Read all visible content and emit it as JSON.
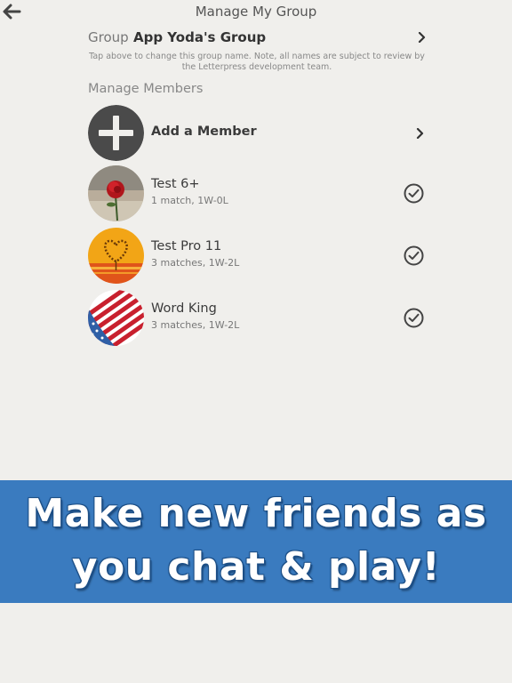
{
  "header": {
    "title": "Manage My Group",
    "back_icon": "arrow-left-icon"
  },
  "group": {
    "label": "Group",
    "name": "App Yoda's Group",
    "note": "Tap above to change this group name. Note, all names are subject to review by the Letterpress development team."
  },
  "members_section": {
    "title": "Manage Members",
    "add_label": "Add a Member",
    "members": [
      {
        "name": "Test 6+",
        "stats": "1 match, 1W-0L",
        "avatar": "rose-photo",
        "selected": true
      },
      {
        "name": "Test Pro 11",
        "stats": "3 matches, 1W-2L",
        "avatar": "sunset-heart-photo",
        "selected": true
      },
      {
        "name": "Word King",
        "stats": "3 matches, 1W-2L",
        "avatar": "flag-globe-photo",
        "selected": true
      }
    ]
  },
  "banner": {
    "line1": "Make new friends as",
    "line2": "you chat & play!"
  },
  "colors": {
    "background": "#f0efec",
    "banner": "#3a7bbf",
    "banner_text": "#ffffff",
    "add_button": "#4a4a4a"
  }
}
